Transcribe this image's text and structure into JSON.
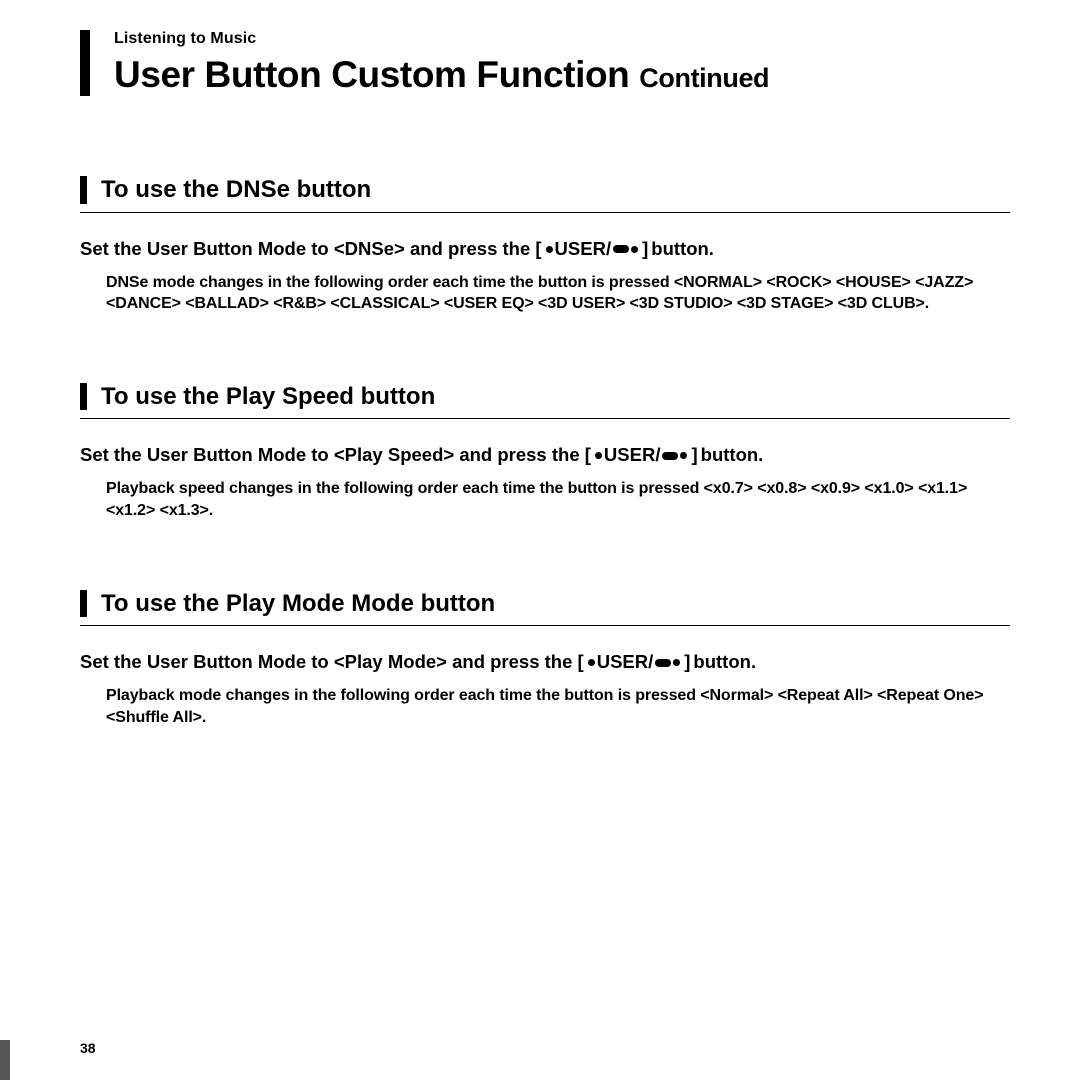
{
  "breadcrumb": "Listening to Music",
  "title_main": "User Button Custom Function",
  "title_cont": "Continued",
  "user_label": "USER/",
  "button_word": "button.",
  "sections": [
    {
      "heading": "To use the DNSe button",
      "instr_pre": "Set the User Button Mode to <DNSe> and press the [",
      "instr_post": "]",
      "detail": "DNSe mode changes in the following order each time the button is pressed <NORMAL> <ROCK> <HOUSE> <JAZZ> <DANCE> <BALLAD> <R&B> <CLASSICAL> <USER EQ> <3D USER> <3D STUDIO> <3D STAGE> <3D CLUB>."
    },
    {
      "heading": "To use the Play Speed button",
      "instr_pre": "Set the User Button Mode to <Play Speed> and press the [",
      "instr_post": "]",
      "detail": "Playback speed changes in the following order each time the button is pressed <x0.7> <x0.8> <x0.9> <x1.0> <x1.1> <x1.2> <x1.3>."
    },
    {
      "heading": "To use the Play Mode Mode button",
      "instr_pre": "Set the User Button Mode to <Play Mode> and press the [",
      "instr_post": "]",
      "detail": "Playback mode changes in the following order each time the button is pressed <Normal> <Repeat All> <Repeat One> <Shuffle All>."
    }
  ],
  "page_number": "38"
}
